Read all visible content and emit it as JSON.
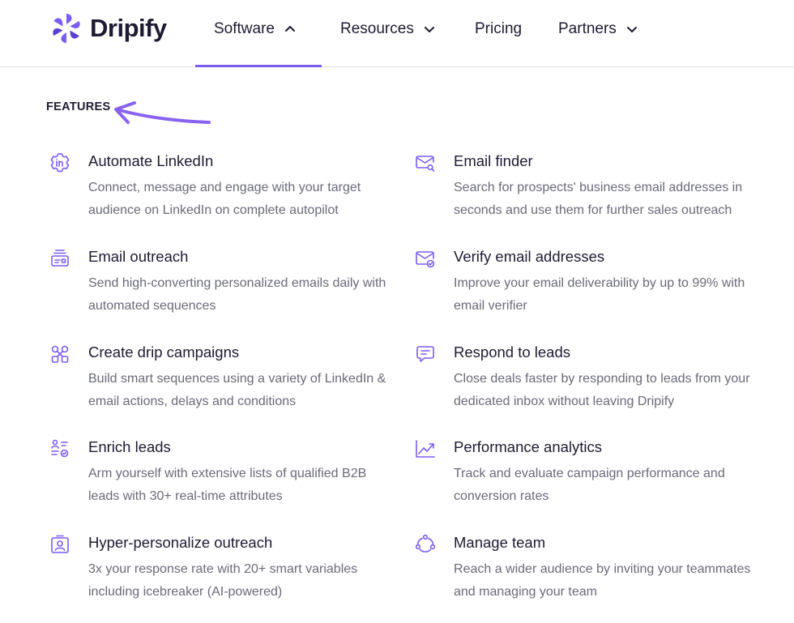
{
  "brand": {
    "name": "Dripify",
    "accent": "#7b5cf0",
    "accent_light": "#a48bf5"
  },
  "nav": {
    "items": [
      {
        "label": "Software",
        "chevron": "chevron-up-icon"
      },
      {
        "label": "Resources",
        "chevron": "chevron-down-icon"
      },
      {
        "label": "Pricing"
      },
      {
        "label": "Partners",
        "chevron": "chevron-down-icon"
      }
    ]
  },
  "section": {
    "title": "FEATURES"
  },
  "features": [
    {
      "icon": "linkedin-gear-icon",
      "title": "Automate LinkedIn",
      "desc": "Connect, message and engage with your target audience on LinkedIn on complete autopilot"
    },
    {
      "icon": "email-search-icon",
      "title": "Email finder",
      "desc": "Search for prospects' business email addresses in seconds and use them for further sales outreach"
    },
    {
      "icon": "email-outreach-icon",
      "title": "Email outreach",
      "desc": "Send high-converting personalized emails daily with automated sequences"
    },
    {
      "icon": "email-verified-icon",
      "title": "Verify email addresses",
      "desc": "Improve your email deliverability by up to 99% with email verifier"
    },
    {
      "icon": "drip-campaign-icon",
      "title": "Create drip campaigns",
      "desc": "Build smart sequences using a variety of LinkedIn & email actions, delays and conditions"
    },
    {
      "icon": "chat-message-icon",
      "title": "Respond to leads",
      "desc": "Close deals faster by responding to leads from your dedicated inbox without leaving Dripify"
    },
    {
      "icon": "enrich-leads-icon",
      "title": "Enrich leads",
      "desc": "Arm yourself with extensive lists of qualified B2B leads with 30+ real-time attributes"
    },
    {
      "icon": "analytics-chart-icon",
      "title": "Performance analytics",
      "desc": "Track and evaluate campaign performance and conversion rates"
    },
    {
      "icon": "profile-card-icon",
      "title": "Hyper-personalize outreach",
      "desc": "3x your response rate with 20+ smart variables including icebreaker (AI-powered)"
    },
    {
      "icon": "team-icon",
      "title": "Manage team",
      "desc": "Reach a wider audience by inviting your teammates and managing your team"
    }
  ]
}
